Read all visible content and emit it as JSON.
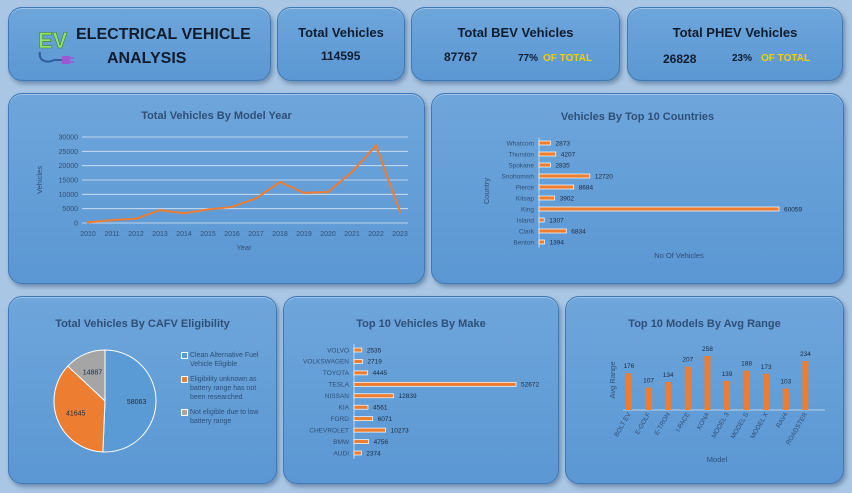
{
  "header": {
    "logo_text": "EV",
    "title_line1": "ELECTRICAL VEHICLE",
    "title_line2": "ANALYSIS"
  },
  "kpis": {
    "total": {
      "title": "Total Vehicles",
      "value": "114595"
    },
    "bev": {
      "title": "Total BEV Vehicles",
      "value": "87767",
      "pct": "77%",
      "of_label": "OF TOTAL"
    },
    "phev": {
      "title": "Total PHEV Vehicles",
      "value": "26828",
      "pct": "23%",
      "of_label": "OF TOTAL"
    }
  },
  "colors": {
    "orange": "#ed7d31",
    "blue": "#5b9bd5",
    "gray": "#a5a5a5",
    "accent_yellow": "#f4d000"
  },
  "chart_data": [
    {
      "type": "line",
      "title": "Total Vehicles By Model Year",
      "xlabel": "Year",
      "ylabel": "Vehicles",
      "x": [
        "2010",
        "2011",
        "2012",
        "2013",
        "2014",
        "2015",
        "2016",
        "2017",
        "2018",
        "2019",
        "2020",
        "2021",
        "2022",
        "2023"
      ],
      "values": [
        200,
        1000,
        1500,
        4500,
        3400,
        4700,
        5600,
        8600,
        14300,
        10500,
        10800,
        17800,
        27000,
        4000
      ],
      "ylim": [
        0,
        30000
      ],
      "yticks": [
        "0",
        "5000",
        "10000",
        "15000",
        "20000",
        "25000",
        "30000"
      ],
      "grid": true
    },
    {
      "type": "bar",
      "orientation": "horizontal",
      "title": "Vehicles By Top 10 Countries",
      "xlabel": "No Of Vehicles",
      "ylabel": "Country",
      "categories": [
        "Whatcom",
        "Thurston",
        "Spokane",
        "Snohomish",
        "Pierce",
        "Kitsap",
        "King",
        "Island",
        "Clark",
        "Benton"
      ],
      "values": [
        2873,
        4207,
        2835,
        12720,
        8684,
        3902,
        60059,
        1307,
        6834,
        1394
      ]
    },
    {
      "type": "pie",
      "title": "Total Vehicles By CAFV Eligibility",
      "slices": [
        {
          "label": "Clean Alternative Fuel Vehicle Eligible",
          "value": 58063,
          "color": "#5b9bd5"
        },
        {
          "label": "Eligibility unknown as battery range has not been researched",
          "value": 41645,
          "color": "#ed7d31"
        },
        {
          "label": "Not eligible due to low battery range",
          "value": 14887,
          "color": "#a5a5a5"
        }
      ],
      "legend": "right"
    },
    {
      "type": "bar",
      "orientation": "horizontal",
      "title": "Top 10 Vehicles By Make",
      "categories": [
        "VOLVO",
        "VOLKSWAGEN",
        "TOYOTA",
        "TESLA",
        "NISSAN",
        "KIA",
        "FORD",
        "CHEVROLET",
        "BMW",
        "AUDI"
      ],
      "values": [
        2535,
        2719,
        4445,
        52672,
        12839,
        4561,
        6071,
        10273,
        4756,
        2374
      ]
    },
    {
      "type": "bar",
      "title": "Top 10 Models By Avg Range",
      "xlabel": "Model",
      "ylabel": "Avg Range",
      "categories": [
        "BOLT EV",
        "E-GOLF",
        "E-TRON",
        "I-PACE",
        "KONA",
        "MODEL 3",
        "MODEL S",
        "MODEL X",
        "RAV4",
        "ROADSTER"
      ],
      "values": [
        176,
        107,
        134,
        207,
        258,
        139,
        188,
        173,
        103,
        234
      ]
    }
  ]
}
